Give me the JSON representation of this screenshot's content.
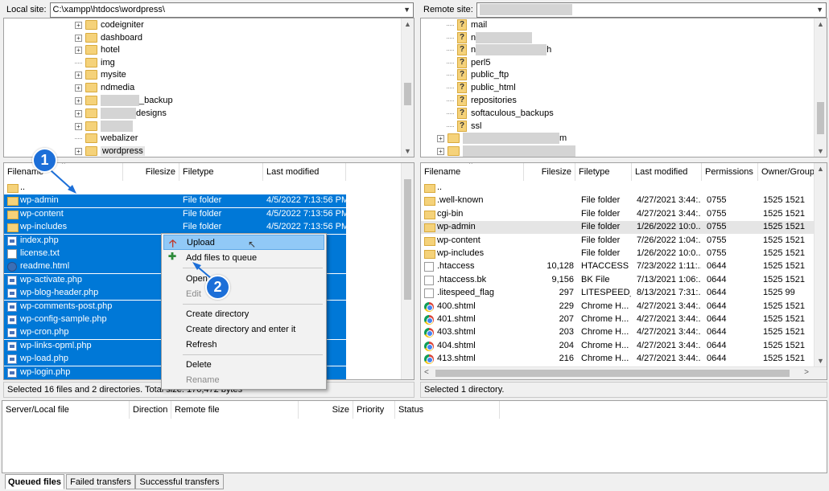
{
  "local": {
    "site_label": "Local site:",
    "site_path": "C:\\xampp\\htdocs\\wordpress\\",
    "tree": [
      "codeigniter",
      "dashboard",
      "hotel",
      "img",
      "mysite",
      "ndmedia",
      "_backup",
      "designs",
      "",
      "webalizer",
      "wordpress"
    ],
    "headers": {
      "filename": "Filename",
      "filesize": "Filesize",
      "filetype": "Filetype",
      "modified": "Last modified"
    },
    "files": [
      {
        "name": "..",
        "size": "",
        "type": "",
        "date": ""
      },
      {
        "name": "wp-admin",
        "size": "",
        "type": "File folder",
        "date": "4/5/2022 7:13:56 PM"
      },
      {
        "name": "wp-content",
        "size": "",
        "type": "File folder",
        "date": "4/5/2022 7:13:56 PM"
      },
      {
        "name": "wp-includes",
        "size": "",
        "type": "File folder",
        "date": "4/5/2022 7:13:56 PM"
      },
      {
        "name": "index.php",
        "size": "",
        "type": "",
        "date": "AM"
      },
      {
        "name": "license.txt",
        "size": "19,",
        "type": "",
        "date": "AM"
      },
      {
        "name": "readme.html",
        "size": "7,",
        "type": "",
        "date": "04..."
      },
      {
        "name": "wp-activate.php",
        "size": "7,",
        "type": "",
        "date": "0 ..."
      },
      {
        "name": "wp-blog-header.php",
        "size": "",
        "type": "",
        "date": "AM"
      },
      {
        "name": "wp-comments-post.php",
        "size": "2,",
        "type": "",
        "date": "02..."
      },
      {
        "name": "wp-config-sample.php",
        "size": "3,",
        "type": "",
        "date": "2..."
      },
      {
        "name": "wp-cron.php",
        "size": "3,",
        "type": "",
        "date": "PM"
      },
      {
        "name": "wp-links-opml.php",
        "size": "2,",
        "type": "",
        "date": "02..."
      },
      {
        "name": "wp-load.php",
        "size": "3,",
        "type": "",
        "date": "6 ..."
      },
      {
        "name": "wp-login.php",
        "size": "47,",
        "type": "",
        "date": "AM"
      }
    ],
    "status": "Selected 16 files and 2 directories. Total size: 170,472 bytes"
  },
  "remote": {
    "site_label": "Remote site:",
    "tree": [
      "mail",
      "",
      "",
      "perl5",
      "public_ftp",
      "public_html",
      "repositories",
      "softaculous_backups",
      "ssl",
      "",
      ""
    ],
    "tree_fragments": {
      "row2": "n",
      "row3": "n",
      "row3_suffix": "h",
      "row10_suffix": "m"
    },
    "headers": {
      "filename": "Filename",
      "filesize": "Filesize",
      "filetype": "Filetype",
      "modified": "Last modified",
      "perms": "Permissions",
      "owner": "Owner/Group"
    },
    "files": [
      {
        "name": "..",
        "size": "",
        "type": "",
        "date": "",
        "perm": "",
        "owner": "",
        "icon": "folder"
      },
      {
        "name": ".well-known",
        "size": "",
        "type": "File folder",
        "date": "4/27/2021 3:44:...",
        "perm": "0755",
        "owner": "1525 1521",
        "icon": "folder"
      },
      {
        "name": "cgi-bin",
        "size": "",
        "type": "File folder",
        "date": "4/27/2021 3:44:...",
        "perm": "0755",
        "owner": "1525 1521",
        "icon": "folder"
      },
      {
        "name": "wp-admin",
        "size": "",
        "type": "File folder",
        "date": "1/26/2022 10:0...",
        "perm": "0755",
        "owner": "1525 1521",
        "icon": "folder"
      },
      {
        "name": "wp-content",
        "size": "",
        "type": "File folder",
        "date": "7/26/2022 1:04:...",
        "perm": "0755",
        "owner": "1525 1521",
        "icon": "folder"
      },
      {
        "name": "wp-includes",
        "size": "",
        "type": "File folder",
        "date": "1/26/2022 10:0...",
        "perm": "0755",
        "owner": "1525 1521",
        "icon": "folder"
      },
      {
        "name": ".htaccess",
        "size": "10,128",
        "type": "HTACCESS ...",
        "date": "7/23/2022 1:11:...",
        "perm": "0644",
        "owner": "1525 1521",
        "icon": "txt"
      },
      {
        "name": ".htaccess.bk",
        "size": "9,156",
        "type": "BK File",
        "date": "7/13/2021 1:06:...",
        "perm": "0644",
        "owner": "1525 1521",
        "icon": "txt"
      },
      {
        "name": ".litespeed_flag",
        "size": "297",
        "type": "LITESPEED_...",
        "date": "8/13/2021 7:31:...",
        "perm": "0644",
        "owner": "1525 99",
        "icon": "txt"
      },
      {
        "name": "400.shtml",
        "size": "229",
        "type": "Chrome H...",
        "date": "4/27/2021 3:44:...",
        "perm": "0644",
        "owner": "1525 1521",
        "icon": "chrome"
      },
      {
        "name": "401.shtml",
        "size": "207",
        "type": "Chrome H...",
        "date": "4/27/2021 3:44:...",
        "perm": "0644",
        "owner": "1525 1521",
        "icon": "chrome"
      },
      {
        "name": "403.shtml",
        "size": "203",
        "type": "Chrome H...",
        "date": "4/27/2021 3:44:...",
        "perm": "0644",
        "owner": "1525 1521",
        "icon": "chrome"
      },
      {
        "name": "404.shtml",
        "size": "204",
        "type": "Chrome H...",
        "date": "4/27/2021 3:44:...",
        "perm": "0644",
        "owner": "1525 1521",
        "icon": "chrome"
      },
      {
        "name": "413.shtml",
        "size": "216",
        "type": "Chrome H...",
        "date": "4/27/2021 3:44:...",
        "perm": "0644",
        "owner": "1525 1521",
        "icon": "chrome"
      }
    ],
    "status": "Selected 1 directory."
  },
  "context_menu": {
    "upload": "Upload",
    "add_queue": "Add files to queue",
    "open": "Open",
    "edit": "Edit",
    "create_dir": "Create directory",
    "create_dir_enter": "Create directory and enter it",
    "refresh": "Refresh",
    "delete": "Delete",
    "rename": "Rename"
  },
  "queue": {
    "headers": {
      "server_local": "Server/Local file",
      "direction": "Direction",
      "remote": "Remote file",
      "size": "Size",
      "priority": "Priority",
      "status": "Status"
    },
    "tabs": {
      "queued": "Queued files",
      "failed": "Failed transfers",
      "successful": "Successful transfers"
    }
  },
  "badges": {
    "one": "1",
    "two": "2"
  },
  "colors": {
    "selection": "#0078d7",
    "menu_highlight": "#91c9f7",
    "badge": "#1c6fd8"
  }
}
